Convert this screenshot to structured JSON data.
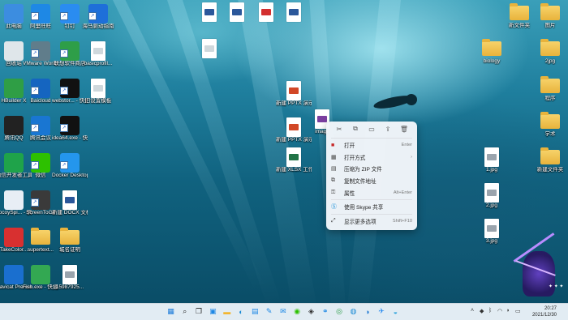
{
  "desktop_icons_left": [
    {
      "label": "此电脑",
      "icon": "computer-icon",
      "color": "#3c8de0"
    },
    {
      "label": "回收站",
      "icon": "recycle-bin-icon",
      "color": "#dfe6ea"
    },
    {
      "label": "HBuilder X",
      "icon": "hbuilder-icon",
      "color": "#2f9e45"
    },
    {
      "label": "腾讯QQ",
      "icon": "qq-penguin-icon",
      "color": "#222222"
    },
    {
      "label": "微信开发者工具",
      "icon": "wechat-devtools-icon",
      "color": "#1fa34a"
    },
    {
      "label": "LocoySpi... - 快捷方式",
      "icon": "locoy-spider-icon",
      "color": "#e8eef5"
    },
    {
      "label": "TakeColor...",
      "icon": "takecolor-icon",
      "color": "#d83030"
    },
    {
      "label": "Navicat Premium 15",
      "icon": "navicat-icon",
      "color": "#1a6fcf"
    }
  ],
  "desktop_icons_col2": [
    {
      "label": "阿里旺旺",
      "icon": "aliwangwang-icon",
      "color": "#1e88e5"
    },
    {
      "label": "VMware Workstati...",
      "icon": "vmware-icon",
      "color": "#607d8b"
    },
    {
      "label": "Baicloud",
      "icon": "baicloud-icon",
      "color": "#1565c0"
    },
    {
      "label": "腾讯会议",
      "icon": "tencent-meeting-icon",
      "color": "#1976d2"
    },
    {
      "label": "微信",
      "icon": "wechat-icon",
      "color": "#2dc100"
    },
    {
      "label": "ScreenToGif",
      "icon": "screentogif-icon",
      "color": "#3a3a3a"
    },
    {
      "label": "supertext...",
      "icon": "folder-icon",
      "color": "#f2c94c"
    },
    {
      "label": "Fish.exe - 快捷方式",
      "icon": "fish-exe-icon",
      "color": "#33a852"
    }
  ],
  "desktop_icons_col3": [
    {
      "label": "钉钉",
      "icon": "dingtalk-icon",
      "color": "#2a8cf0"
    },
    {
      "label": "联想软件商店",
      "icon": "lenovo-store-icon",
      "color": "#2e9e48"
    },
    {
      "label": "webstor... - 快捷方式",
      "icon": "webstorm-icon",
      "color": "#111111"
    },
    {
      "label": "idea64.exe - 快捷方式",
      "icon": "intellij-idea-icon",
      "color": "#111111"
    },
    {
      "label": "Docker Desktop",
      "icon": "docker-icon",
      "color": "#2496ed"
    },
    {
      "label": "新建 DOCX 文档.docx",
      "icon": "word-document-icon",
      "color": "#2b579a"
    },
    {
      "label": "城名证明",
      "icon": "folder-icon",
      "color": "#f2c94c"
    },
    {
      "label": "15987925...",
      "icon": "image-file-icon",
      "color": "#c62828"
    }
  ],
  "desktop_icons_col4": [
    {
      "label": "海马驱动指南",
      "icon": "driver-icon",
      "color": "#1e6fd9"
    },
    {
      "label": "basicprofil...",
      "icon": "document-icon",
      "color": "#ffffff"
    },
    {
      "label": "旧设置模板",
      "icon": "document-icon",
      "color": "#ffffff"
    }
  ],
  "desktop_icons_top": [
    {
      "label": "",
      "icon": "word-document-icon"
    },
    {
      "label": "",
      "icon": "word-document-icon"
    },
    {
      "label": "",
      "icon": "pdf-document-icon"
    },
    {
      "label": "",
      "icon": "word-document-icon"
    },
    {
      "label": "",
      "icon": "document-icon"
    }
  ],
  "desktop_icons_middle": [
    {
      "label": "新建 PPTX 演示文稿 (2)...",
      "icon": "powerpoint-icon"
    },
    {
      "label": "新建 PPTX 演示文稿.pptx",
      "icon": "powerpoint-icon"
    },
    {
      "label": "新建 XLSX 工作表.xlsx",
      "icon": "excel-icon"
    },
    {
      "label": "image",
      "icon": "winrar-archive-icon"
    }
  ],
  "desktop_icons_right": [
    {
      "label": "新文件夹",
      "icon": "folder-icon"
    },
    {
      "label": "图片",
      "icon": "folder-icon"
    },
    {
      "label": "biology",
      "icon": "folder-icon"
    },
    {
      "label": "2jpg",
      "icon": "folder-icon"
    },
    {
      "label": "程序",
      "icon": "folder-icon"
    },
    {
      "label": "学术",
      "icon": "folder-icon"
    },
    {
      "label": "1.jpg",
      "icon": "image-file-icon"
    },
    {
      "label": "2.jpg",
      "icon": "image-file-icon"
    },
    {
      "label": "3.jpg",
      "icon": "image-file-icon"
    },
    {
      "label": "新建文件夹",
      "icon": "folder-icon"
    }
  ],
  "context_menu": {
    "toolbar": [
      {
        "icon": "cut-icon",
        "glyph": "✂"
      },
      {
        "icon": "copy-icon",
        "glyph": "⧉"
      },
      {
        "icon": "rename-icon",
        "glyph": "▭"
      },
      {
        "icon": "share-icon",
        "glyph": "⇪"
      },
      {
        "icon": "delete-icon",
        "glyph": "🗑"
      }
    ],
    "items": [
      {
        "label": "打开",
        "shortcut": "Enter",
        "icon": "open-icon",
        "glyph": "■",
        "color": "#c62828"
      },
      {
        "label": "打开方式",
        "shortcut": "›",
        "icon": "open-with-icon",
        "glyph": "▦",
        "color": "#444444"
      },
      {
        "label": "压缩为 ZIP 文件",
        "shortcut": "",
        "icon": "zip-icon",
        "glyph": "▤",
        "color": "#444444"
      },
      {
        "label": "复制文件地址",
        "shortcut": "",
        "icon": "copy-path-icon",
        "glyph": "⧉",
        "color": "#444444"
      },
      {
        "label": "属性",
        "shortcut": "Alt+Enter",
        "icon": "properties-icon",
        "glyph": "⚿",
        "color": "#444444"
      },
      {
        "label": "使用 Skype 共享",
        "shortcut": "",
        "icon": "skype-icon",
        "glyph": "Ⓢ",
        "color": "#0a8ad8"
      },
      {
        "label": "显示更多选项",
        "shortcut": "Shift+F10",
        "icon": "more-options-icon",
        "glyph": "⤢",
        "color": "#444444"
      }
    ]
  },
  "taskbar": {
    "apps": [
      {
        "icon": "windows-start-icon",
        "color": "#1a7ad9",
        "glyph": "▦"
      },
      {
        "icon": "search-icon",
        "color": "#222222",
        "glyph": "⌕"
      },
      {
        "icon": "task-view-icon",
        "color": "#222222",
        "glyph": "❐"
      },
      {
        "icon": "widgets-icon",
        "color": "#1e88e5",
        "glyph": "▣"
      },
      {
        "icon": "file-explorer-icon",
        "color": "#f2b632",
        "glyph": "▬"
      },
      {
        "icon": "edge-icon",
        "color": "#1a8ad4",
        "glyph": "◐"
      },
      {
        "icon": "store-icon",
        "color": "#1e88e5",
        "glyph": "▤"
      },
      {
        "icon": "pen-app-icon",
        "color": "#1e88e5",
        "glyph": "✎"
      },
      {
        "icon": "mail-icon",
        "color": "#1e88e5",
        "glyph": "✉"
      },
      {
        "icon": "chat-app-icon",
        "color": "#2dc100",
        "glyph": "◉"
      },
      {
        "icon": "camera-app-icon",
        "color": "#333333",
        "glyph": "◈"
      },
      {
        "icon": "network-app-icon",
        "color": "#1e88e5",
        "glyph": "⚭"
      },
      {
        "icon": "chrome-icon",
        "color": "#2e9e48",
        "glyph": "◎"
      },
      {
        "icon": "browser-icon",
        "color": "#1a8ad4",
        "glyph": "◍"
      },
      {
        "icon": "tencent-meeting-icon",
        "color": "#1976d2",
        "glyph": "◑"
      },
      {
        "icon": "dingtalk-icon",
        "color": "#2a8cf0",
        "glyph": "✈"
      },
      {
        "icon": "app-icon",
        "color": "#26a0da",
        "glyph": "◒"
      }
    ],
    "tray": [
      {
        "icon": "show-hidden-icon",
        "glyph": "˄"
      },
      {
        "icon": "app-tray-icon",
        "glyph": "◆"
      },
      {
        "icon": "bluetooth-icon",
        "glyph": "ᛒ"
      },
      {
        "icon": "wifi-icon",
        "glyph": "◠"
      },
      {
        "icon": "volume-icon",
        "glyph": "◗"
      },
      {
        "icon": "battery-icon",
        "glyph": "▭"
      }
    ],
    "time": "20:27",
    "date": "2021/12/30"
  }
}
